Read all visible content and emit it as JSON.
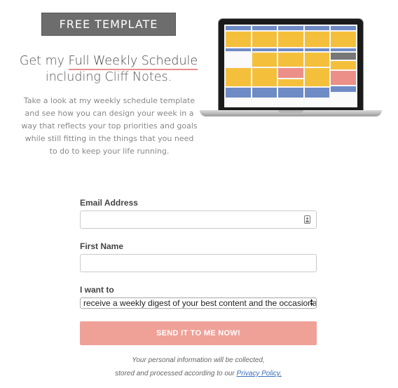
{
  "badge": {
    "text": "FREE TEMPLATE"
  },
  "headline": {
    "prefix": "Get my ",
    "highlight": "Full Weekly Schedule",
    "line2": "including Cliff Notes."
  },
  "description": "Take a look at my weekly schedule template and see how you can design your week in a way that reflects your top priorities and goals while still fitting in the things that you need to do to keep your life running.",
  "form": {
    "email_label": "Email Address",
    "email_value": "",
    "first_name_label": "First Name",
    "first_name_value": "",
    "want_label": "I want to",
    "want_selected": "receive a weekly digest of your best content and the occasional",
    "submit_label": "SEND IT TO ME NOW!"
  },
  "privacy": {
    "line1": "Your personal information will be collected,",
    "line2_prefix": "stored and processed according to our ",
    "link": "Privacy Policy."
  },
  "colors": {
    "badge_bg": "#6d6d6d",
    "button_bg": "#efa198",
    "underline": "#e98b8b",
    "schedule_yellow": "#f4c03c",
    "schedule_blue": "#6f8bc6",
    "schedule_pink": "#ec8f88"
  },
  "icons": {
    "contact_card": "contact-card-icon",
    "select_arrows": "select-arrows-icon"
  }
}
